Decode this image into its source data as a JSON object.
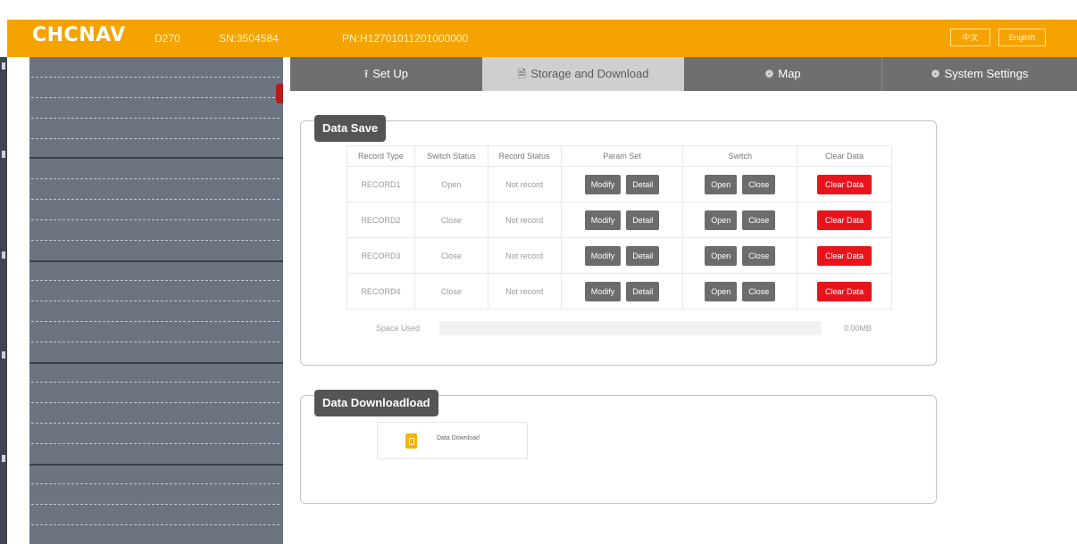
{
  "header": {
    "brand": "CHCNAV",
    "model": "D270",
    "sn": "SN:3504584",
    "pn": "PN:H12701011201000000",
    "button_1_label": "中文",
    "button_2_label": "English"
  },
  "tabs": [
    {
      "label": "Set Up",
      "icon": "upload-icon",
      "active": false
    },
    {
      "label": "Storage and Download",
      "icon": "document-icon",
      "active": true
    },
    {
      "label": "Map",
      "icon": "map-icon",
      "active": false
    },
    {
      "label": "System Settings",
      "icon": "settings-icon",
      "active": false
    }
  ],
  "data_save": {
    "legend": "Data Save",
    "columns": [
      "Record Type",
      "Switch Status",
      "Record Status",
      "Param Set",
      "Switch",
      "Clear Data"
    ],
    "rows": [
      {
        "type": "RECORD1",
        "switch_status": "Open",
        "record_status": "Not record",
        "modify": "Modify",
        "detail": "Detail",
        "open": "Open",
        "close": "Close",
        "clear": "Clear Data"
      },
      {
        "type": "RECORD2",
        "switch_status": "Close",
        "record_status": "Not record",
        "modify": "Modify",
        "detail": "Detail",
        "open": "Open",
        "close": "Close",
        "clear": "Clear Data"
      },
      {
        "type": "RECORD3",
        "switch_status": "Close",
        "record_status": "Not record",
        "modify": "Modify",
        "detail": "Detail",
        "open": "Open",
        "close": "Close",
        "clear": "Clear Data"
      },
      {
        "type": "RECORD4",
        "switch_status": "Close",
        "record_status": "Not record",
        "modify": "Modify",
        "detail": "Detail",
        "open": "Open",
        "close": "Close",
        "clear": "Clear Data"
      }
    ],
    "space_used_label": "Space Used",
    "space_used_value": "0.00MB",
    "space_used_fraction": 0
  },
  "data_download": {
    "legend": "Data Downloadload",
    "item_label": "Data Download",
    "item_icon": "file-icon"
  },
  "colors": {
    "brand": "#f5a300",
    "danger": "#e8141c",
    "tab_bar": "#6f6f6f",
    "sidebar": "#6c7482"
  }
}
